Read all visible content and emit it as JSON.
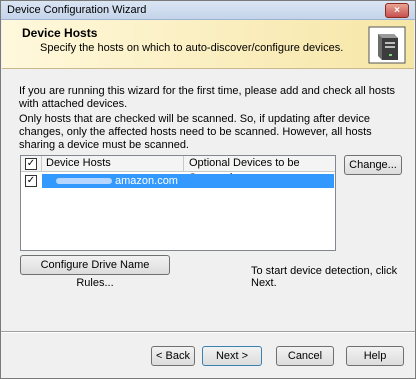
{
  "window": {
    "title": "Device Configuration Wizard",
    "close_glyph": "×"
  },
  "header": {
    "title": "Device Hosts",
    "subtitle": "Specify the hosts on which to auto-discover/configure devices.",
    "icon": "computer-tower-icon"
  },
  "body": {
    "intro": "If you are running this wizard for the first time, please add and check all hosts with attached devices.",
    "scan_note": "Only hosts that are checked will be scanned.  So, if updating after device changes, only the affected hosts need to be scanned.  However, all hosts sharing a device must be scanned."
  },
  "grid": {
    "columns": [
      "Device Hosts",
      "Optional Devices to be Scanned"
    ],
    "header_checked": true,
    "rows": [
      {
        "checked": true,
        "host_suffix": "amazon.com",
        "optional_devices": ""
      }
    ]
  },
  "buttons": {
    "change": "Change...",
    "configure_rules": "Configure Drive Name Rules...",
    "back": "< Back",
    "next": "Next >",
    "cancel": "Cancel",
    "help": "Help"
  },
  "detect_hint": "To start device detection, click Next.",
  "colors": {
    "header_bg": "#f6e6a6",
    "selection": "#3399ff"
  }
}
